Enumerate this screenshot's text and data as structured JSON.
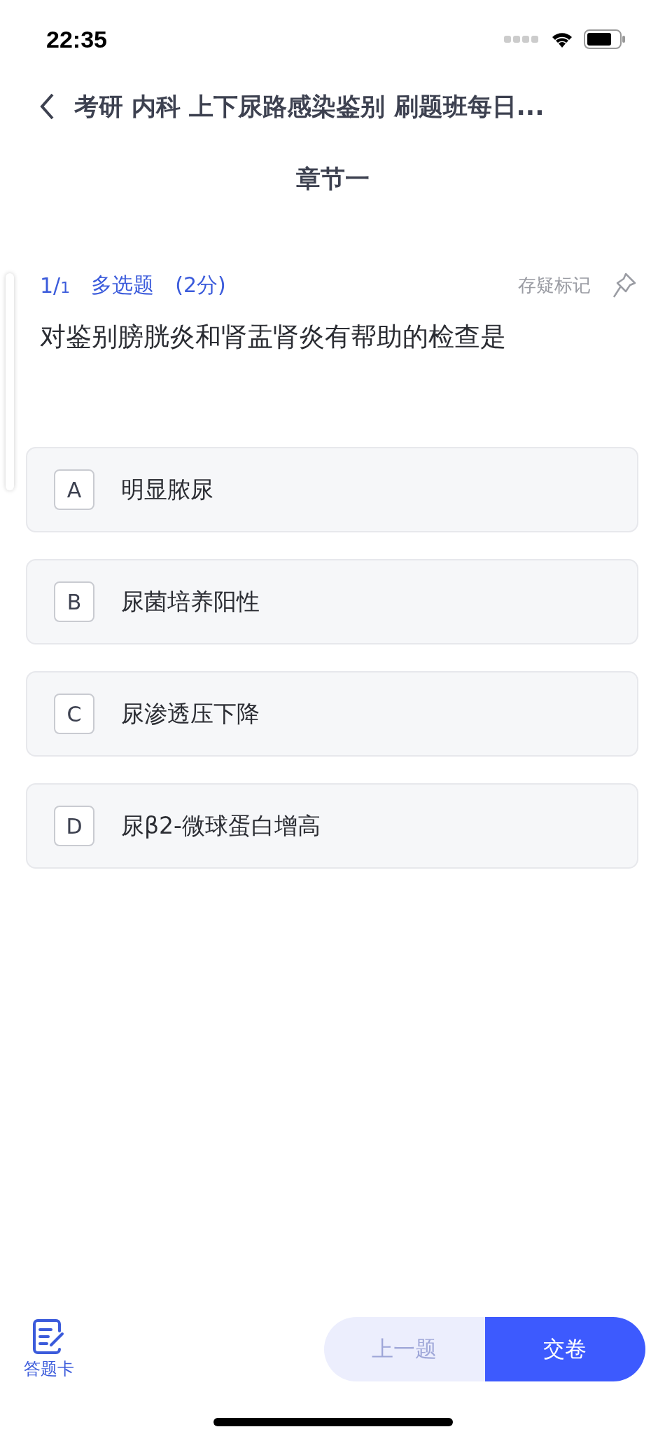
{
  "status_bar": {
    "time": "22:35"
  },
  "nav": {
    "title": "考研 内科 上下尿路感染鉴别 刷题班每日..."
  },
  "chapter": "章节一",
  "question": {
    "index": "1/",
    "total": "1",
    "type": "多选题",
    "score": "(2分)",
    "mark_label": "存疑标记",
    "marked": false,
    "text": "对鉴别膀胱炎和肾盂肾炎有帮助的检查是"
  },
  "options": [
    {
      "letter": "A",
      "text": "明显脓尿",
      "selected": false
    },
    {
      "letter": "B",
      "text": "尿菌培养阳性",
      "selected": false
    },
    {
      "letter": "C",
      "text": "尿渗透压下降",
      "selected": false
    },
    {
      "letter": "D",
      "text": "尿β2-微球蛋白增高",
      "selected": false
    }
  ],
  "bottom_bar": {
    "card_label": "答题卡",
    "prev": {
      "label": "上一题",
      "disabled": true
    },
    "submit": {
      "label": "交卷"
    }
  }
}
